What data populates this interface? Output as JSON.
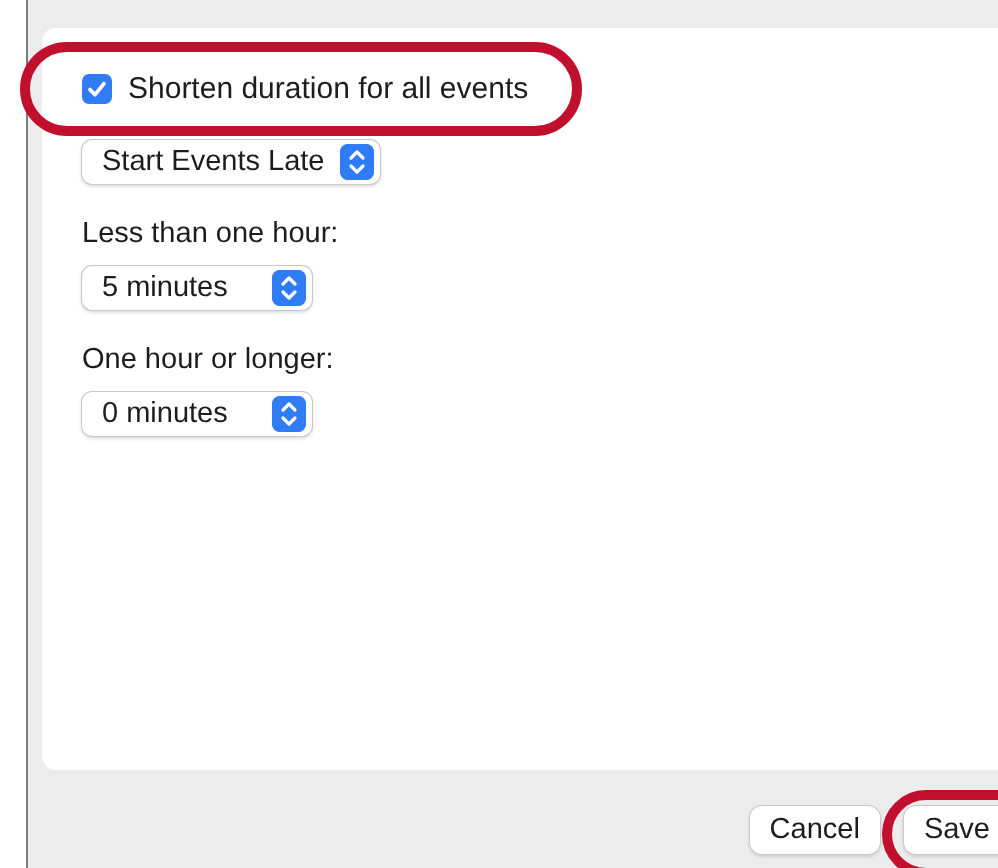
{
  "shorten": {
    "label": "Shorten duration for all events",
    "checked": true,
    "highlighted": true
  },
  "mode_select": {
    "value": "Start Events Late"
  },
  "fields": [
    {
      "label": "Less than one hour:",
      "value": "5 minutes"
    },
    {
      "label": "One hour or longer:",
      "value": "0 minutes"
    }
  ],
  "buttons": [
    {
      "label": "Cancel",
      "highlighted": false
    },
    {
      "label": "Save",
      "highlighted": true
    }
  ]
}
